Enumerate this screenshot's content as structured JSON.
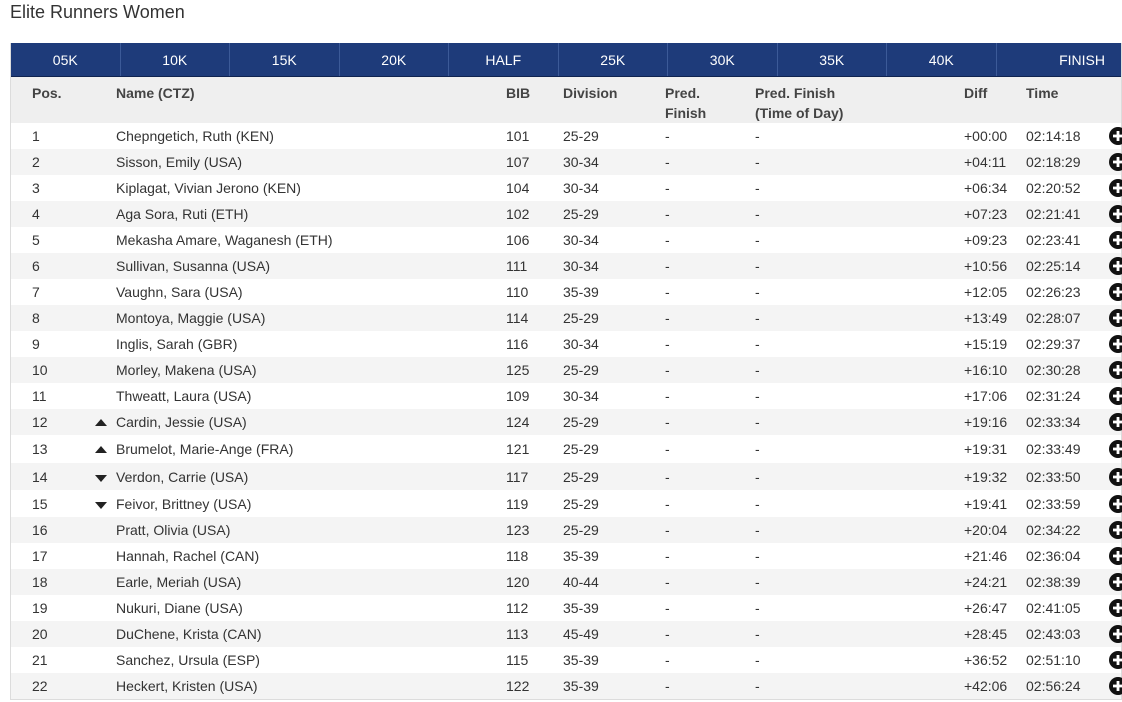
{
  "page_title": "Elite Runners Women",
  "splits": [
    "05K",
    "10K",
    "15K",
    "20K",
    "HALF",
    "25K",
    "30K",
    "35K",
    "40K",
    "FINISH"
  ],
  "columns": {
    "pos": "Pos.",
    "name": "Name (CTZ)",
    "bib": "BIB",
    "division": "Division",
    "pred_finish_1": "Pred.",
    "pred_finish_2": "Finish",
    "pred_tod_1": "Pred. Finish",
    "pred_tod_2": "(Time of Day)",
    "diff": "Diff",
    "time": "Time"
  },
  "colors": {
    "header_bar": "#1e3b7a",
    "header_text": "#ffffff",
    "stripe": "#f4f4f4",
    "column_header_bg": "#efefef"
  },
  "rows": [
    {
      "pos": "1",
      "trend": "none",
      "name": "Chepngetich, Ruth (KEN)",
      "bib": "101",
      "division": "25-29",
      "pred_finish": "-",
      "pred_tod": "-",
      "diff": "+00:00",
      "time": "02:14:18"
    },
    {
      "pos": "2",
      "trend": "none",
      "name": "Sisson, Emily (USA)",
      "bib": "107",
      "division": "30-34",
      "pred_finish": "-",
      "pred_tod": "-",
      "diff": "+04:11",
      "time": "02:18:29"
    },
    {
      "pos": "3",
      "trend": "none",
      "name": "Kiplagat, Vivian Jerono (KEN)",
      "bib": "104",
      "division": "30-34",
      "pred_finish": "-",
      "pred_tod": "-",
      "diff": "+06:34",
      "time": "02:20:52"
    },
    {
      "pos": "4",
      "trend": "none",
      "name": "Aga Sora, Ruti (ETH)",
      "bib": "102",
      "division": "25-29",
      "pred_finish": "-",
      "pred_tod": "-",
      "diff": "+07:23",
      "time": "02:21:41"
    },
    {
      "pos": "5",
      "trend": "none",
      "name": "Mekasha Amare, Waganesh (ETH)",
      "bib": "106",
      "division": "30-34",
      "pred_finish": "-",
      "pred_tod": "-",
      "diff": "+09:23",
      "time": "02:23:41"
    },
    {
      "pos": "6",
      "trend": "none",
      "name": "Sullivan, Susanna (USA)",
      "bib": "111",
      "division": "30-34",
      "pred_finish": "-",
      "pred_tod": "-",
      "diff": "+10:56",
      "time": "02:25:14"
    },
    {
      "pos": "7",
      "trend": "none",
      "name": "Vaughn, Sara (USA)",
      "bib": "110",
      "division": "35-39",
      "pred_finish": "-",
      "pred_tod": "-",
      "diff": "+12:05",
      "time": "02:26:23"
    },
    {
      "pos": "8",
      "trend": "none",
      "name": "Montoya, Maggie (USA)",
      "bib": "114",
      "division": "25-29",
      "pred_finish": "-",
      "pred_tod": "-",
      "diff": "+13:49",
      "time": "02:28:07"
    },
    {
      "pos": "9",
      "trend": "none",
      "name": "Inglis, Sarah (GBR)",
      "bib": "116",
      "division": "30-34",
      "pred_finish": "-",
      "pred_tod": "-",
      "diff": "+15:19",
      "time": "02:29:37"
    },
    {
      "pos": "10",
      "trend": "none",
      "name": "Morley, Makena (USA)",
      "bib": "125",
      "division": "25-29",
      "pred_finish": "-",
      "pred_tod": "-",
      "diff": "+16:10",
      "time": "02:30:28"
    },
    {
      "pos": "11",
      "trend": "none",
      "name": "Thweatt, Laura (USA)",
      "bib": "109",
      "division": "30-34",
      "pred_finish": "-",
      "pred_tod": "-",
      "diff": "+17:06",
      "time": "02:31:24"
    },
    {
      "pos": "12",
      "trend": "up",
      "name": "Cardin, Jessie (USA)",
      "bib": "124",
      "division": "25-29",
      "pred_finish": "-",
      "pred_tod": "-",
      "diff": "+19:16",
      "time": "02:33:34"
    },
    {
      "pos": "13",
      "trend": "up",
      "name": "Brumelot, Marie-Ange (FRA)",
      "bib": "121",
      "division": "25-29",
      "pred_finish": "-",
      "pred_tod": "-",
      "diff": "+19:31",
      "time": "02:33:49"
    },
    {
      "pos": "14",
      "trend": "down",
      "name": "Verdon, Carrie (USA)",
      "bib": "117",
      "division": "25-29",
      "pred_finish": "-",
      "pred_tod": "-",
      "diff": "+19:32",
      "time": "02:33:50"
    },
    {
      "pos": "15",
      "trend": "down",
      "name": "Feivor, Brittney (USA)",
      "bib": "119",
      "division": "25-29",
      "pred_finish": "-",
      "pred_tod": "-",
      "diff": "+19:41",
      "time": "02:33:59"
    },
    {
      "pos": "16",
      "trend": "none",
      "name": "Pratt, Olivia (USA)",
      "bib": "123",
      "division": "25-29",
      "pred_finish": "-",
      "pred_tod": "-",
      "diff": "+20:04",
      "time": "02:34:22"
    },
    {
      "pos": "17",
      "trend": "none",
      "name": "Hannah, Rachel (CAN)",
      "bib": "118",
      "division": "35-39",
      "pred_finish": "-",
      "pred_tod": "-",
      "diff": "+21:46",
      "time": "02:36:04"
    },
    {
      "pos": "18",
      "trend": "none",
      "name": "Earle, Meriah (USA)",
      "bib": "120",
      "division": "40-44",
      "pred_finish": "-",
      "pred_tod": "-",
      "diff": "+24:21",
      "time": "02:38:39"
    },
    {
      "pos": "19",
      "trend": "none",
      "name": "Nukuri, Diane (USA)",
      "bib": "112",
      "division": "35-39",
      "pred_finish": "-",
      "pred_tod": "-",
      "diff": "+26:47",
      "time": "02:41:05"
    },
    {
      "pos": "20",
      "trend": "none",
      "name": "DuChene, Krista (CAN)",
      "bib": "113",
      "division": "45-49",
      "pred_finish": "-",
      "pred_tod": "-",
      "diff": "+28:45",
      "time": "02:43:03"
    },
    {
      "pos": "21",
      "trend": "none",
      "name": "Sanchez, Ursula (ESP)",
      "bib": "115",
      "division": "35-39",
      "pred_finish": "-",
      "pred_tod": "-",
      "diff": "+36:52",
      "time": "02:51:10"
    },
    {
      "pos": "22",
      "trend": "none",
      "name": "Heckert, Kristen (USA)",
      "bib": "122",
      "division": "35-39",
      "pred_finish": "-",
      "pred_tod": "-",
      "diff": "+42:06",
      "time": "02:56:24"
    }
  ]
}
